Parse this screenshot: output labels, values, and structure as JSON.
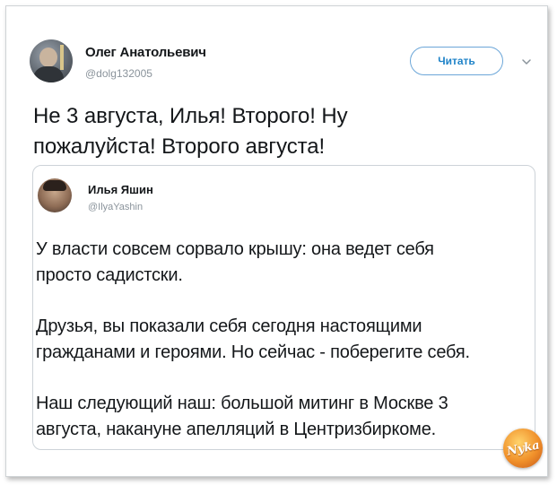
{
  "tweet": {
    "author_name": "Олег Анатольевич",
    "author_handle": "@dolg132005",
    "follow_label": "Читать",
    "text_line1": "Не 3 августа, Илья! Второго! Ну",
    "text_line2": "пожалуйста! Второго августа!"
  },
  "quoted": {
    "author_name": "Илья Яшин",
    "author_handle": "@IlyaYashin",
    "p1_line1": "У власти совсем сорвало крышу: она ведет себя",
    "p1_line2": "просто садистски.",
    "p2_line1": "Друзья, вы показали себя сегодня настоящими",
    "p2_line2": "гражданами и героями. Но сейчас - поберегите себя.",
    "p3_line1": "Наш следующий наш: большой митинг в Москве 3",
    "p3_line2": "августа, накануне апелляций в Центризбиркоме."
  },
  "watermark": {
    "text": "Nyka"
  },
  "colors": {
    "accent": "#1f83c8",
    "border": "#cdd3d8",
    "muted": "#8a939b"
  }
}
